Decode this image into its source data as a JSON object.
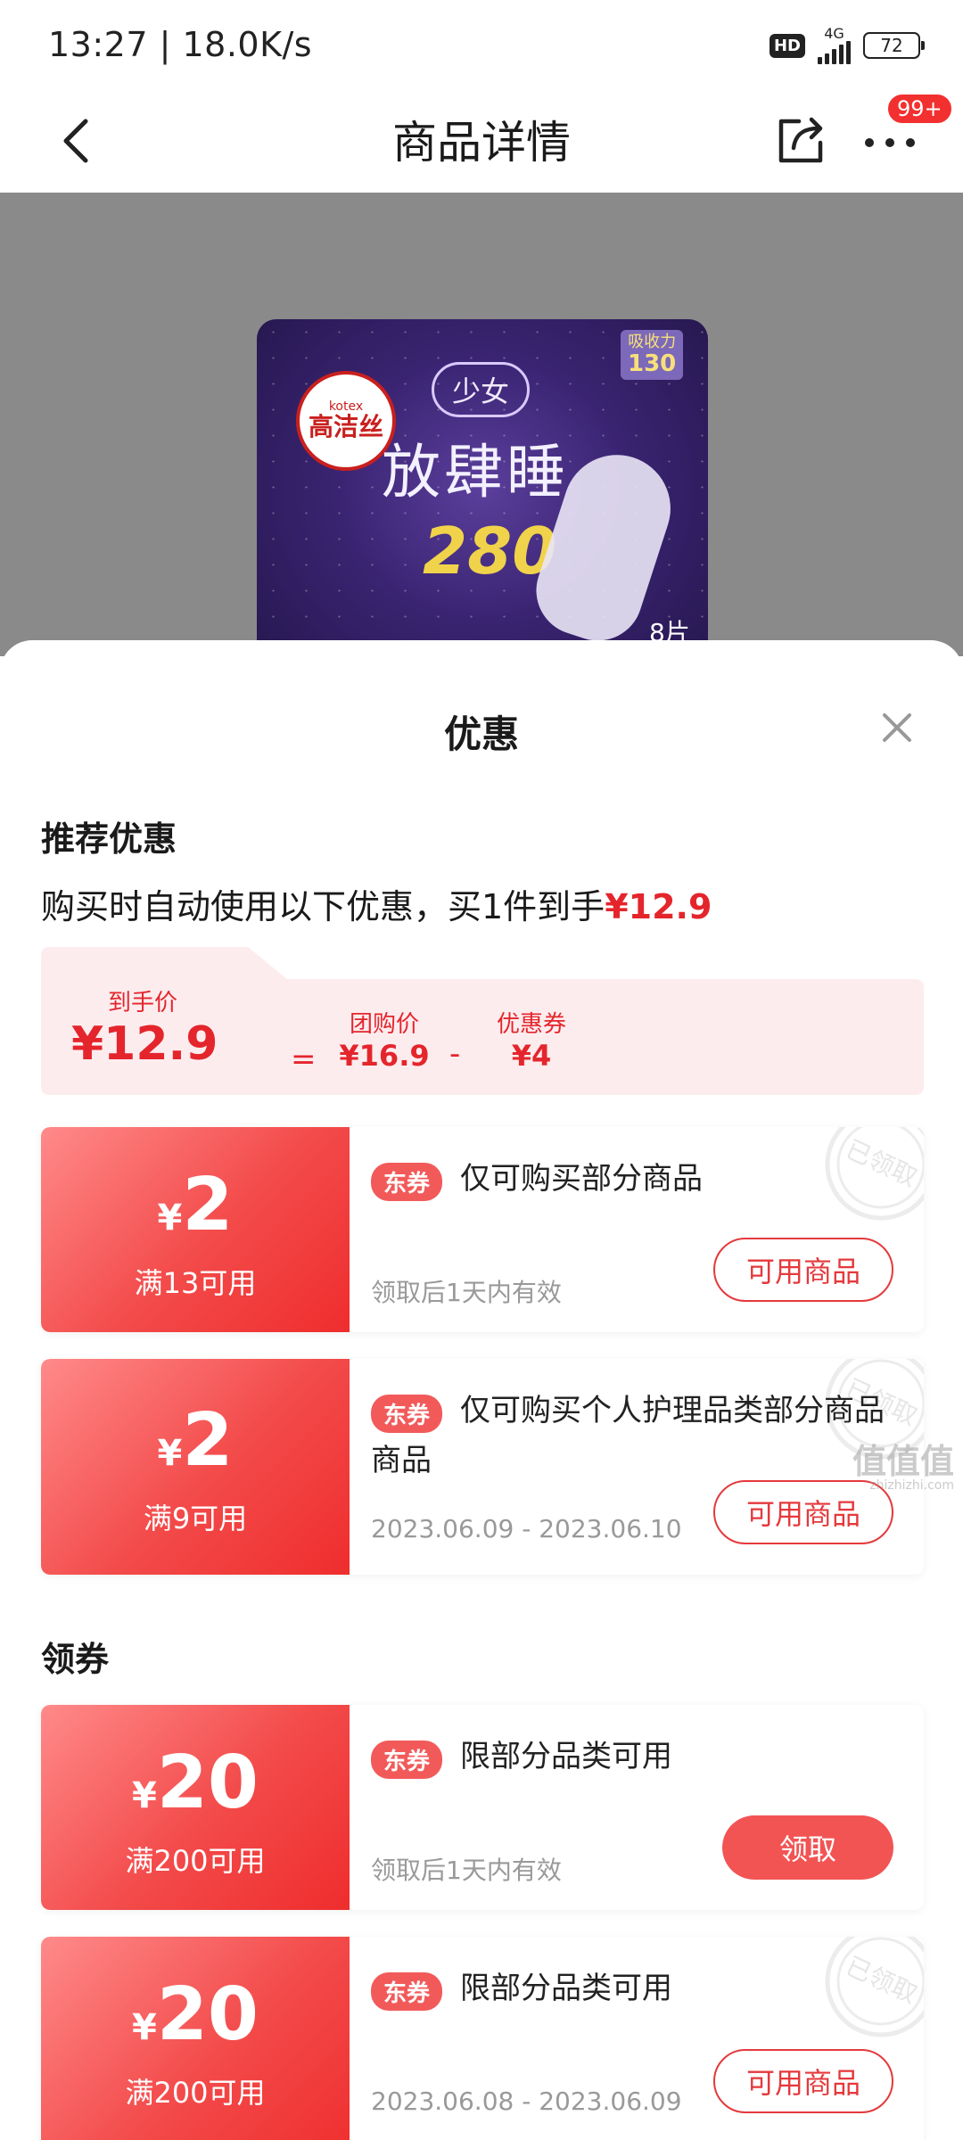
{
  "status_bar": {
    "time": "13:27 | 18.0K/s",
    "hd": "HD",
    "network": "4G",
    "battery": "72"
  },
  "header": {
    "title": "商品详情",
    "badge": "99+"
  },
  "product_image": {
    "brand": "高洁丝",
    "brand_en": "kotex",
    "series": "少女",
    "name": "放肆睡",
    "length": "280",
    "absorb_label": "吸收力",
    "absorb_value": "130",
    "count": "8片"
  },
  "sheet": {
    "title": "优惠",
    "recommended_title": "推荐优惠",
    "auto_text": "购买时自动使用以下优惠，买1件到手",
    "auto_price": "¥12.9",
    "summary": {
      "final_label": "到手价",
      "final_price": "¥12.9",
      "equals": "=",
      "group_label": "团购价",
      "group_price": "¥16.9",
      "minus": "-",
      "coupon_label": "优惠券",
      "coupon_price": "¥4"
    },
    "coupons": [
      {
        "yen": "¥",
        "amount": "2",
        "condition": "满13可用",
        "tag": "东券",
        "desc": "仅可购买部分商品",
        "validity": "领取后1天内有效",
        "button": "可用商品",
        "stamp": "已领取"
      },
      {
        "yen": "¥",
        "amount": "2",
        "condition": "满9可用",
        "tag": "东券",
        "desc": "仅可购买个人护理品类部分商品",
        "desc_line2": "商品",
        "validity": "2023.06.09 - 2023.06.10",
        "button": "可用商品",
        "stamp": "已领取"
      }
    ],
    "claim_title": "领券",
    "claim_coupons": [
      {
        "yen": "¥",
        "amount": "20",
        "condition": "满200可用",
        "tag": "东券",
        "desc": "限部分品类可用",
        "validity": "领取后1天内有效",
        "button": "领取"
      },
      {
        "yen": "¥",
        "amount": "20",
        "condition": "满200可用",
        "tag": "东券",
        "desc": "限部分品类可用",
        "validity": "2023.06.08 - 2023.06.09",
        "button": "可用商品",
        "stamp": "已领取"
      }
    ]
  },
  "watermark": {
    "text": "值值值",
    "url": "zhizhizhi.com"
  },
  "colors": {
    "accent_red": "#e4252c",
    "coupon_gradient_start": "#ff8a8a",
    "coupon_gradient_end": "#ef2d2d",
    "summary_bg": "#fdecee"
  }
}
